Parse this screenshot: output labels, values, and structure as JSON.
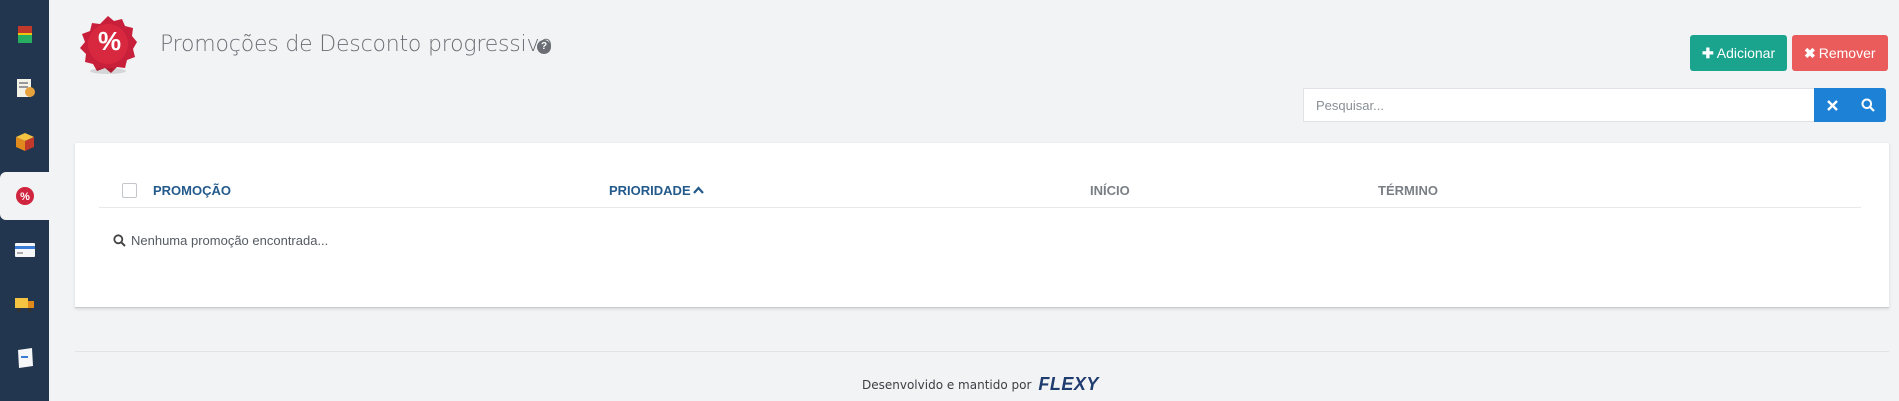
{
  "sidebar": {
    "items": [
      {
        "icon": "box-stack-icon",
        "active": false
      },
      {
        "icon": "document-gear-icon",
        "active": false
      },
      {
        "icon": "package-icon",
        "active": false
      },
      {
        "icon": "percent-badge-icon",
        "active": true
      },
      {
        "icon": "credit-card-icon",
        "active": false
      },
      {
        "icon": "truck-icon",
        "active": false
      },
      {
        "icon": "note-icon",
        "active": false
      }
    ]
  },
  "header": {
    "logo_symbol": "%",
    "title": "Promoções de Desconto progressivo",
    "help_symbol": "?"
  },
  "actions": {
    "add_icon": "✚",
    "add_label": "Adicionar",
    "remove_icon": "✖",
    "remove_label": "Remover"
  },
  "search": {
    "placeholder": "Pesquisar...",
    "value": ""
  },
  "table": {
    "columns": [
      {
        "label": "PROMOÇÃO",
        "sortable": true
      },
      {
        "label": "PRIORIDADE",
        "sortable": true,
        "sorted": "asc"
      },
      {
        "label": "INÍCIO",
        "sortable": false
      },
      {
        "label": "TÉRMINO",
        "sortable": false
      }
    ],
    "empty_message": "Nenhuma promoção encontrada..."
  },
  "footer": {
    "text": "Desenvolvido e mantido por",
    "brand": "FLEXY"
  },
  "colors": {
    "sidebar": "#22364f",
    "add_button": "#1aa38d",
    "remove_button": "#ea5b5b",
    "search_button": "#1d82d6",
    "header_link": "#235a8c",
    "logo_badge": "#d0253e"
  }
}
